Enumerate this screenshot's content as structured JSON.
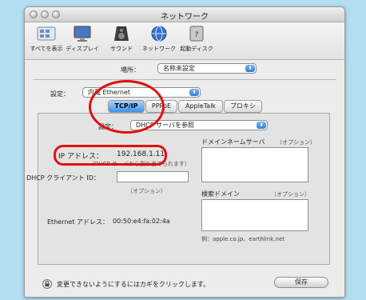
{
  "window": {
    "title": "ネットワーク"
  },
  "toolbar": {
    "items": [
      {
        "label": "すべてを表示",
        "icon": "show-all-icon"
      },
      {
        "label": "ディスプレイ",
        "icon": "display-icon"
      },
      {
        "label": "サウンド",
        "icon": "sound-icon"
      },
      {
        "label": "ネットワーク",
        "icon": "network-icon"
      },
      {
        "label": "起動ディスク",
        "icon": "startup-disk-icon"
      }
    ]
  },
  "location": {
    "label": "場所：",
    "value": "名称未設定"
  },
  "show": {
    "label": "設定：",
    "value": "内蔵 Ethernet"
  },
  "tabs": [
    {
      "label": "TCP/IP",
      "active": true
    },
    {
      "label": "PPPoE",
      "active": false
    },
    {
      "label": "AppleTalk",
      "active": false
    },
    {
      "label": "プロキシ",
      "active": false
    }
  ],
  "configure": {
    "label": "設定：",
    "value": "DHCP サーバを参照"
  },
  "ip": {
    "label": "IP アドレス：",
    "value": "192.168.1.11",
    "note": "（DHCP サーバから割り当てられます）"
  },
  "dhcp_client": {
    "label": "DHCP クライアント ID：",
    "optional": "（オプション）",
    "value": ""
  },
  "ethernet": {
    "label": "Ethernet アドレス：",
    "value": "00:50:e4:fa:02:4a"
  },
  "dns": {
    "label": "ドメインネームサーバ",
    "optional": "（オプション）",
    "value": ""
  },
  "search": {
    "label": "検索ドメイン",
    "optional": "（オプション）",
    "value": "",
    "example": "例：apple.co.jp、earthlink.net"
  },
  "footer": {
    "lock_text": "変更できないようにするにはカギをクリックします。",
    "save_label": "保存"
  },
  "colors": {
    "background": "#b3def2",
    "annotation": "#e01010",
    "accent": "#3f92e8"
  }
}
